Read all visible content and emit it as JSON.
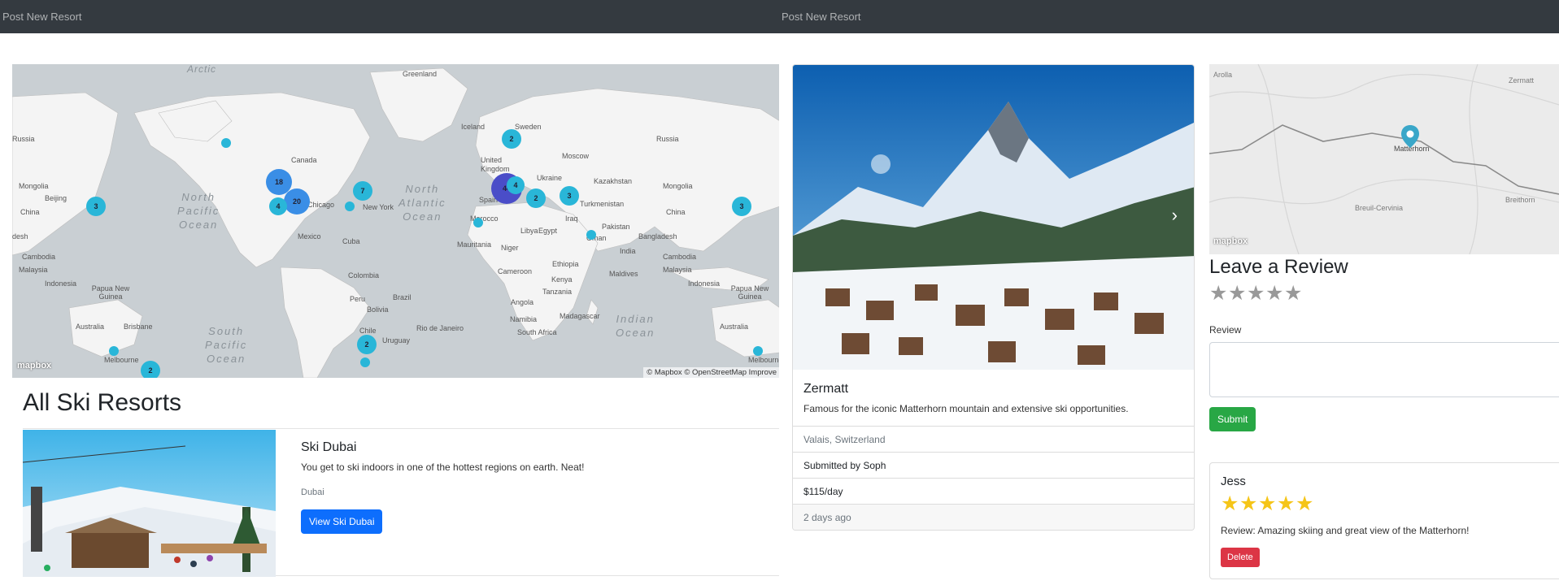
{
  "left": {
    "navbar": {
      "brand_link": "Post New Resort"
    },
    "map": {
      "labels": {
        "arctic": "Arctic",
        "greenland": "Greenland",
        "iceland": "Iceland",
        "russia_w": "Russia",
        "russia_e": "Russia",
        "sweden": "Sweden",
        "canada": "Canada",
        "mongolia_w": "Mongolia",
        "mongolia_e": "Mongolia",
        "beijing": "Beijing",
        "china_w": "China",
        "china_e": "China",
        "kazakhstan": "Kazakhstan",
        "turkmenistan": "Turkmenistan",
        "pakistan": "Pakistan",
        "united_kingdom": "United Kingdom",
        "moscow": "Moscow",
        "ukraine": "Ukraine",
        "spain": "Spain",
        "morocco": "Morocco",
        "mauritania": "Mauritania",
        "niger": "Niger",
        "libya": "Libya",
        "egypt": "Egypt",
        "iraq": "Iraq",
        "oman": "Oman",
        "chicago": "Chicago",
        "new_york": "New York",
        "mexico": "Mexico",
        "cuba": "Cuba",
        "colombia": "Colombia",
        "peru": "Peru",
        "brazil": "Brazil",
        "bolivia": "Bolivia",
        "chile": "Chile",
        "uruguay": "Uruguay",
        "rio": "Rio de Janeiro",
        "cameroon": "Cameroon",
        "ethiopia": "Ethiopia",
        "kenya": "Kenya",
        "tanzania": "Tanzania",
        "angola": "Angola",
        "namibia": "Namibia",
        "madagascar": "Madagascar",
        "south_africa": "South Africa",
        "maldives": "Maldives",
        "malaysia_w": "Malaysia",
        "malaysia_e": "Malaysia",
        "indonesia_w": "Indonesia",
        "indonesia_e": "Indonesia",
        "cambodia_w": "Cambodia",
        "cambodia_e": "Cambodia",
        "bangladesh": "Bangladesh",
        "india": "India",
        "desh": "desh",
        "papua_w": "Papua New Guinea",
        "papua_e": "Papua New Guinea",
        "australia_w": "Australia",
        "australia_e": "Australia",
        "brisbane": "Brisbane",
        "melbourne_w": "Melbourne",
        "melbourne_e": "Melbourne",
        "china_far_w": "China"
      },
      "oceans": {
        "north_pacific": "North\nPacific\nOcean",
        "north_atlantic": "North\nAtlantic\nOcean",
        "south_pacific": "South\nPacific\nOcean",
        "indian": "Indian\nOcean"
      },
      "clusters": [
        "3",
        "18",
        "20",
        "4",
        "7",
        "2",
        "44",
        "4",
        "2",
        "3",
        "3",
        "2",
        "2"
      ],
      "logo": "mapbox",
      "attribution": "© Mapbox © OpenStreetMap  Improve"
    },
    "heading": "All Ski Resorts",
    "resort": {
      "title": "Ski Dubai",
      "description": "You get to ski indoors in one of the hottest regions on earth. Neat!",
      "location": "Dubai",
      "view_button": "View Ski Dubai"
    }
  },
  "right": {
    "navbar": {
      "brand_link": "Post New Resort"
    },
    "resort": {
      "title": "Zermatt",
      "description": "Famous for the iconic Matterhorn mountain and extensive ski opportunities.",
      "location": "Valais, Switzerland",
      "submitted_by": "Submitted by Soph",
      "price": "$115/day",
      "posted": "2 days ago"
    },
    "mini_map": {
      "labels": {
        "arolla": "Arolla",
        "zermatt": "Zermatt",
        "matterhorn": "Matterhorn",
        "breuil": "Breuil-Cervinia",
        "breithorn": "Breithorn"
      },
      "logo": "mapbox"
    },
    "review_form": {
      "heading": "Leave a Review",
      "rating_value": 0,
      "rating_max": 5,
      "review_label": "Review",
      "review_value": "",
      "submit_button": "Submit"
    },
    "review": {
      "author": "Jess",
      "rating": 5,
      "text": "Review: Amazing skiing and great view of the Matterhorn!",
      "delete_button": "Delete"
    },
    "colors": {
      "primary": "#0d6efd",
      "success": "#28a745",
      "danger": "#dc3545",
      "navbar": "#343a40",
      "star": "#f5c518"
    }
  }
}
